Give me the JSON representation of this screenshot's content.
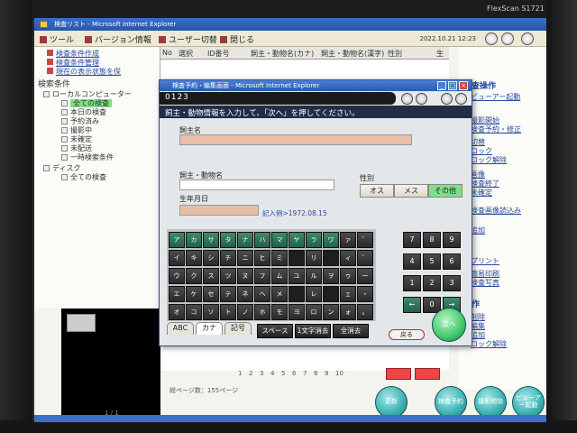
{
  "monitor": {
    "brand": "FlexScan S1721"
  },
  "window": {
    "title": "検査リスト - Microsoft Internet Explorer"
  },
  "toolbar": {
    "tool": "ツール",
    "version": "バージョン情報",
    "user_switch": "ユーザー切替",
    "close": "閉じる",
    "datetime": "2022.10.21 12:23"
  },
  "left_panel": {
    "links": [
      "検査条件作成",
      "検査条件管理",
      "現在の表示状態を保"
    ],
    "cond_heading": "検索条件",
    "tree_root": "ローカルコンピューター",
    "tree_items": [
      "全ての検査",
      "本日の検査",
      "予約済み",
      "撮影中",
      "未確定",
      "未配送",
      "一時検索条件"
    ],
    "disk_root": "ディスク",
    "disk_item": "全ての検査"
  },
  "grid": {
    "headers": [
      "No",
      "選択",
      "ID番号",
      "飼主・動物名(カナ)",
      "飼主・動物名(漢字)",
      "性別",
      "生"
    ],
    "pages": [
      "1",
      "2",
      "3",
      "4",
      "5",
      "6",
      "7",
      "8",
      "9",
      "10"
    ],
    "total": "総ページ数：155ページ",
    "page_indicator": "1 / 1"
  },
  "right_panel": {
    "sections": [
      {
        "head": "検査操作",
        "items": [
          "ビューアー起動",
          "撮影開始",
          "検査予約・修正",
          "切替",
          "ロック",
          "ロック解除"
        ]
      },
      {
        "head": "",
        "items": [
          "画像",
          "検査終了",
          "未確定",
          "検査画像読込み"
        ]
      },
      {
        "head": "",
        "items": [
          "追加",
          "プリント",
          "簡易印刷",
          "検査写真"
        ]
      },
      {
        "head": "操作",
        "items": [
          "削除",
          "編集",
          "追加",
          "ロック解除"
        ]
      }
    ]
  },
  "bottom_buttons": [
    "更新",
    "検査予約",
    "撮影開始",
    "ビューアー起動"
  ],
  "dialog": {
    "title": "検査予約・編集画面 - Microsoft Internet Explorer",
    "code": "0123",
    "instruction": "飼主・動物情報を入力して、「次へ」を押してください。",
    "owner_label": "飼主名",
    "owner_value": "",
    "animal_label": "飼主・動物名",
    "animal_value": "",
    "gender_label": "性別",
    "gender_options": [
      "オス",
      "メス",
      "その他"
    ],
    "gender_selected": "その他",
    "birth_label": "生年月日",
    "birth_value": "",
    "birth_hint": "記入例>1972.08.15",
    "kana_rows": [
      [
        "ア",
        "カ",
        "サ",
        "タ",
        "ナ",
        "ハ",
        "マ",
        "ヤ",
        "ラ",
        "ワ",
        "ァ",
        "゛"
      ],
      [
        "イ",
        "キ",
        "シ",
        "チ",
        "ニ",
        "ヒ",
        "ミ",
        "",
        "リ",
        "",
        "ィ",
        "゜"
      ],
      [
        "ウ",
        "ク",
        "ス",
        "ツ",
        "ヌ",
        "フ",
        "ム",
        "ユ",
        "ル",
        "ヲ",
        "ゥ",
        "ー"
      ],
      [
        "エ",
        "ケ",
        "セ",
        "テ",
        "ネ",
        "ヘ",
        "メ",
        "",
        "レ",
        "",
        "ェ",
        "・"
      ],
      [
        "オ",
        "コ",
        "ソ",
        "ト",
        "ノ",
        "ホ",
        "モ",
        "ヨ",
        "ロ",
        "ン",
        "ォ",
        "。"
      ]
    ],
    "numpad": [
      "7",
      "8",
      "9",
      "4",
      "5",
      "6",
      "1",
      "2",
      "3",
      "←",
      "0",
      "→"
    ],
    "tabs": [
      "ABC",
      "カナ",
      "記号"
    ],
    "active_tab": "カナ",
    "space": "スペース",
    "backspace": "1文字消去",
    "clear_all": "全消去",
    "back": "戻る",
    "next": "次へ"
  },
  "colors": {
    "title_blue": "#2855a8",
    "key_green": "#20614a",
    "next_green": "#43c86a",
    "field_tan": "#e8bfa6"
  }
}
